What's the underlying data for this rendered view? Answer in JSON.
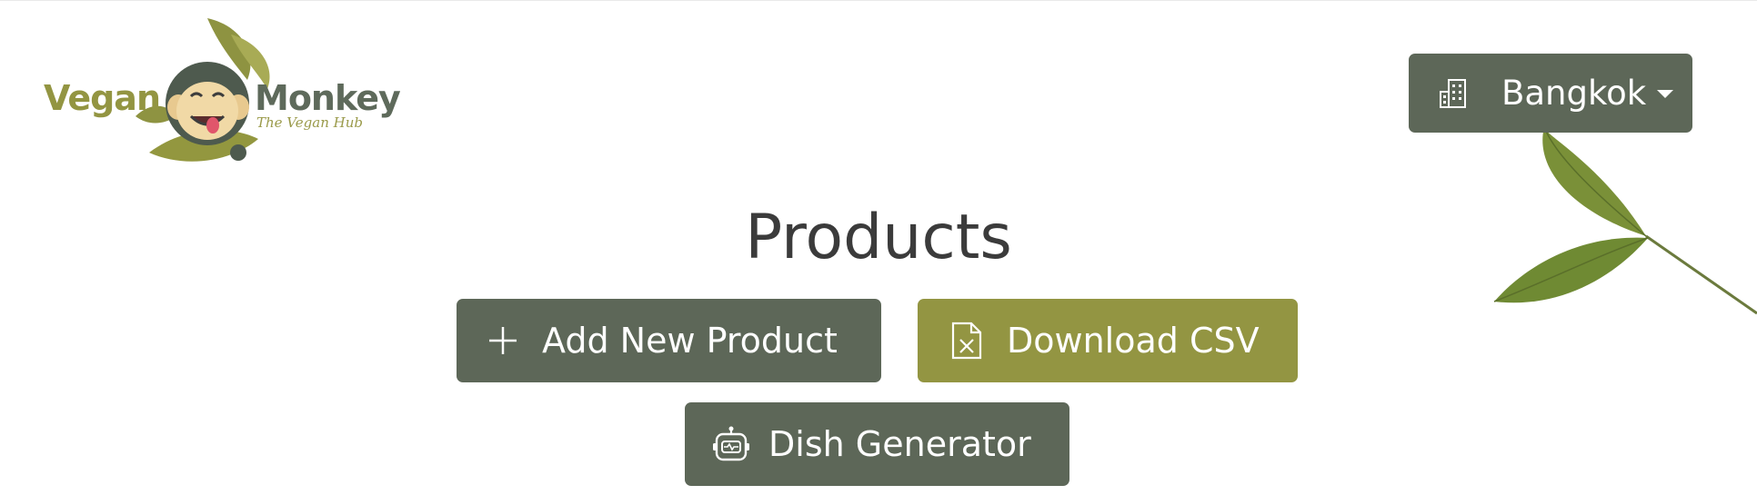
{
  "brand": {
    "name_left": "Vegan",
    "name_right": "Monkey",
    "tagline": "The Vegan Hub",
    "colors": {
      "olive": "#939542",
      "slate": "#5d6758"
    }
  },
  "header": {
    "city_selector": {
      "label": "Bangkok",
      "icon": "building-icon"
    }
  },
  "main": {
    "title": "Products",
    "actions": {
      "add_product": {
        "label": "Add New Product",
        "icon": "plus-icon"
      },
      "download_csv": {
        "label": "Download CSV",
        "icon": "file-excel-icon"
      },
      "dish_generator": {
        "label": "Dish Generator",
        "icon": "robot-icon"
      }
    }
  }
}
